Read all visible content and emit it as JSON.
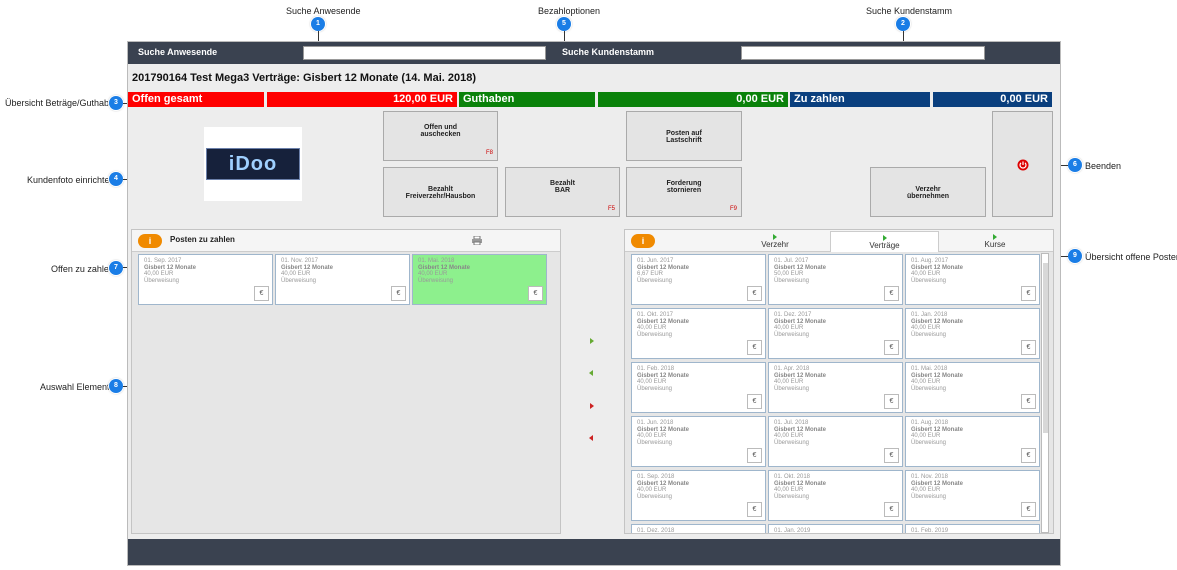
{
  "annotations": [
    {
      "n": "1",
      "text": "Suche Anwesende"
    },
    {
      "n": "5",
      "text": "Bezahloptionen"
    },
    {
      "n": "2",
      "text": "Suche Kundenstamm"
    },
    {
      "n": "3",
      "text": "Übersicht Beträge/Guthaben"
    },
    {
      "n": "4",
      "text": "Kundenfoto einrichten"
    },
    {
      "n": "6",
      "text": "Beenden"
    },
    {
      "n": "7",
      "text": "Offen zu zahlen"
    },
    {
      "n": "8",
      "text": "Auswahl Elemente"
    },
    {
      "n": "9",
      "text": "Übersicht offene Posten"
    }
  ],
  "topbar": {
    "search_present_label": "Suche Anwesende",
    "search_customer_label": "Suche Kundenstamm"
  },
  "title": "201790164  Test Mega3 Verträge: Gisbert 12 Monate (14. Mai. 2018)",
  "summary": {
    "open_label": "Offen gesamt",
    "open_value": "120,00 EUR",
    "credit_label": "Guthaben",
    "credit_value": "0,00 EUR",
    "due_label": "Zu zahlen",
    "due_value": "0,00 EUR",
    "colors": {
      "red": "#ff0000",
      "green": "#0a820a",
      "blue": "#0a3f7e"
    }
  },
  "buttons": {
    "checkout": {
      "l1": "Offen und",
      "l2": "auschecken",
      "key": "F8"
    },
    "debit": {
      "l1": "Posten auf",
      "l2": "Lastschrift"
    },
    "paid_free": {
      "l1": "Bezahlt",
      "l2": "Freiverzehr/Hausbon"
    },
    "paid_cash": {
      "l1": "Bezahlt",
      "l2": "BAR",
      "key": "F5"
    },
    "cancel_claim": {
      "l1": "Forderung",
      "l2": "stornieren",
      "key": "F9"
    },
    "take_consumption": {
      "l1": "Verzehr",
      "l2": "übernehmen"
    }
  },
  "logo_text": "iDoo",
  "left_panel": {
    "title": "Posten zu zahlen",
    "items": [
      {
        "date": "01. Sep. 2017",
        "name": "Gisbert 12 Monate",
        "amount": "40,00 EUR",
        "method": "Überweisung",
        "selected": false
      },
      {
        "date": "01. Nov. 2017",
        "name": "Gisbert 12 Monate",
        "amount": "40,00 EUR",
        "method": "Überweisung",
        "selected": false
      },
      {
        "date": "01. Mai. 2018",
        "name": "Gisbert 12 Monate",
        "amount": "40,00 EUR",
        "method": "Überweisung",
        "selected": true
      }
    ]
  },
  "right_panel": {
    "tabs": [
      "Verzehr",
      "Verträge",
      "Kurse"
    ],
    "active_tab": 1,
    "items": [
      {
        "date": "01. Jun. 2017",
        "name": "Gisbert 12 Monate",
        "amount": "6,67 EUR",
        "method": "Überweisung"
      },
      {
        "date": "01. Jul. 2017",
        "name": "Gisbert 12 Monate",
        "amount": "50,00 EUR",
        "method": "Überweisung"
      },
      {
        "date": "01. Aug. 2017",
        "name": "Gisbert 12 Monate",
        "amount": "40,00 EUR",
        "method": "Überweisung"
      },
      {
        "date": "01. Okt. 2017",
        "name": "Gisbert 12 Monate",
        "amount": "40,00 EUR",
        "method": "Überweisung"
      },
      {
        "date": "01. Dez. 2017",
        "name": "Gisbert 12 Monate",
        "amount": "40,00 EUR",
        "method": "Überweisung"
      },
      {
        "date": "01. Jan. 2018",
        "name": "Gisbert 12 Monate",
        "amount": "40,00 EUR",
        "method": "Überweisung"
      },
      {
        "date": "01. Feb. 2018",
        "name": "Gisbert 12 Monate",
        "amount": "40,00 EUR",
        "method": "Überweisung"
      },
      {
        "date": "01. Apr. 2018",
        "name": "Gisbert 12 Monate",
        "amount": "40,00 EUR",
        "method": "Überweisung"
      },
      {
        "date": "01. Mai. 2018",
        "name": "Gisbert 12 Monate",
        "amount": "40,00 EUR",
        "method": "Überweisung"
      },
      {
        "date": "01. Jun. 2018",
        "name": "Gisbert 12 Monate",
        "amount": "40,00 EUR",
        "method": "Überweisung"
      },
      {
        "date": "01. Jul. 2018",
        "name": "Gisbert 12 Monate",
        "amount": "40,00 EUR",
        "method": "Überweisung"
      },
      {
        "date": "01. Aug. 2018",
        "name": "Gisbert 12 Monate",
        "amount": "40,00 EUR",
        "method": "Überweisung"
      },
      {
        "date": "01. Sep. 2018",
        "name": "Gisbert 12 Monate",
        "amount": "40,00 EUR",
        "method": "Überweisung"
      },
      {
        "date": "01. Okt. 2018",
        "name": "Gisbert 12 Monate",
        "amount": "40,00 EUR",
        "method": "Überweisung"
      },
      {
        "date": "01. Nov. 2018",
        "name": "Gisbert 12 Monate",
        "amount": "40,00 EUR",
        "method": "Überweisung"
      },
      {
        "date": "01. Dez. 2018",
        "name": "",
        "amount": "",
        "method": ""
      },
      {
        "date": "01. Jan. 2019",
        "name": "",
        "amount": "",
        "method": ""
      },
      {
        "date": "01. Feb. 2019",
        "name": "",
        "amount": "",
        "method": ""
      }
    ]
  },
  "euro_symbol": "€",
  "icons": {
    "print": "printer-icon",
    "close": "power-icon",
    "info": "info-icon"
  }
}
